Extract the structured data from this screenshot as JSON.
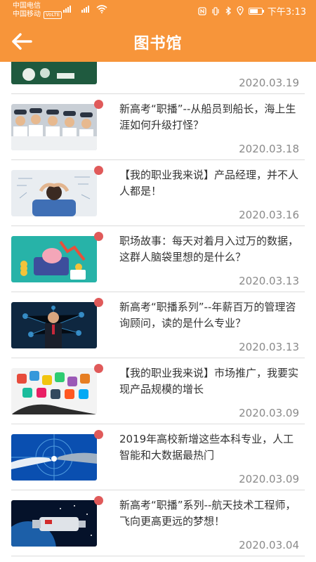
{
  "status_bar": {
    "carrier1": "中国电信",
    "carrier2": "中国移动",
    "volte": "VoLTE",
    "time": "下午3:13",
    "battery_level": 0.7
  },
  "app_bar": {
    "title": "图书馆",
    "back_icon": "arrow-left-icon"
  },
  "articles": [
    {
      "title": "",
      "date": "2020.03.19",
      "unread": false
    },
    {
      "title": "新高考“职播”--从船员到船长，海上生涯如何升级打怪？",
      "date": "2020.03.18",
      "unread": true
    },
    {
      "title": "【我的职业我来说】产品经理，并不人人都是！",
      "date": "2020.03.16",
      "unread": true
    },
    {
      "title": "职场故事：每天对着月入过万的数据，这群人脑袋里想的是什么？",
      "date": "2020.03.13",
      "unread": true
    },
    {
      "title": "新高考“职播系列”--年薪百万的管理咨询顾问，读的是什么专业？",
      "date": "2020.03.13",
      "unread": true
    },
    {
      "title": "【我的职业我来说】市场推广，我要实现产品规模的增长",
      "date": "2020.03.09",
      "unread": true
    },
    {
      "title": "2019年高校新增这些本科专业，人工智能和大数据最热门",
      "date": "2020.03.09",
      "unread": true
    },
    {
      "title": "新高考“职播”系列--航天技术工程师，飞向更高更远的梦想！",
      "date": "2020.03.04",
      "unread": true
    }
  ]
}
